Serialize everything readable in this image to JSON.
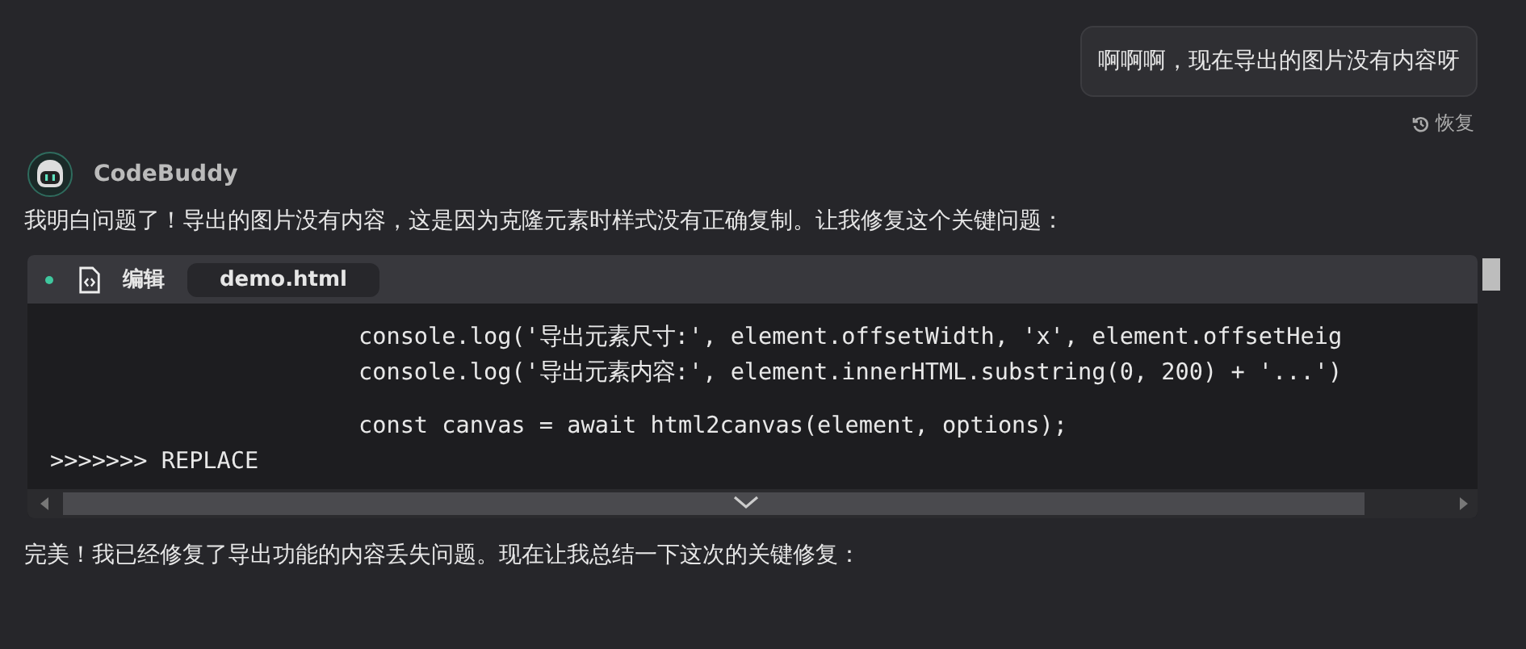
{
  "user_message": {
    "text": "啊啊啊，现在导出的图片没有内容呀",
    "restore_label": "恢复"
  },
  "assistant": {
    "name": "CodeBuddy",
    "intro": "我明白问题了！导出的图片没有内容，这是因为克隆元素时样式没有正确复制。让我修复这个关键问题：",
    "code_block": {
      "status_on": true,
      "action": "编辑",
      "file": "demo.html",
      "lines": [
        {
          "kind": "code",
          "text": "console.log('导出元素尺寸:', element.offsetWidth, 'x', element.offsetHeig"
        },
        {
          "kind": "code",
          "text": "console.log('导出元素内容:', element.innerHTML.substring(0, 200) + '...')"
        },
        {
          "kind": "blank"
        },
        {
          "kind": "code",
          "text": "const canvas = await html2canvas(element, options);"
        },
        {
          "kind": "marker",
          "text": ">>>>>>> REPLACE"
        }
      ]
    },
    "summary": "完美！我已经修复了导出功能的内容丢失问题。现在让我总结一下这次的关键修复："
  }
}
